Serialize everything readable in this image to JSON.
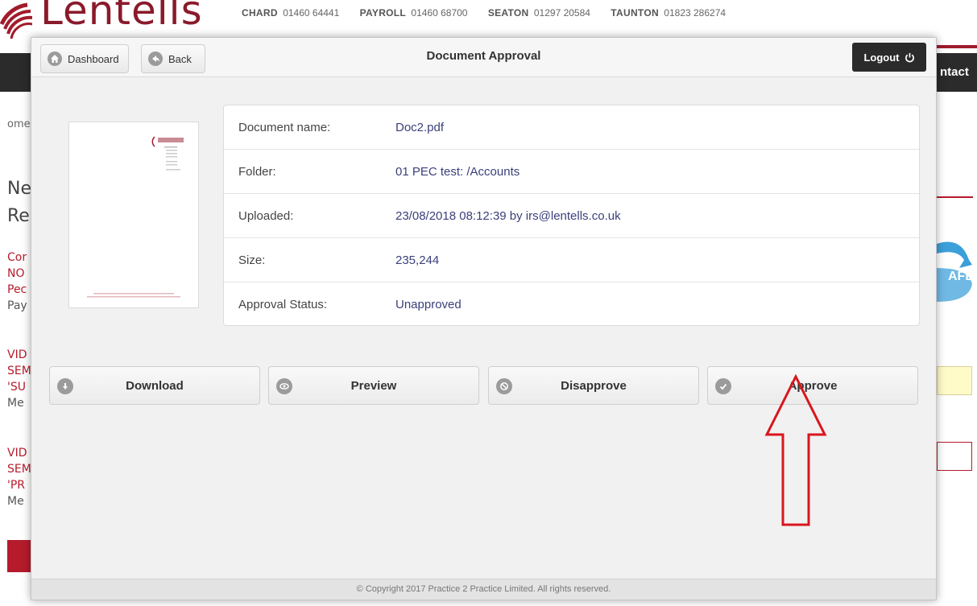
{
  "background": {
    "logo_text": "Lentells",
    "phones": [
      {
        "office": "CHARD",
        "number": "01460 64441"
      },
      {
        "office": "PAYROLL",
        "number": "01460 68700"
      },
      {
        "office": "SEATON",
        "number": "01297 20584"
      },
      {
        "office": "TAUNTON",
        "number": "01823 286274"
      }
    ],
    "nav_fragment": "ntact",
    "left_fragments": {
      "home": "ome",
      "heading_1": "Ne",
      "heading_2": "Re",
      "l1": "Cor",
      "l2": "NO",
      "l3": "Pec",
      "l4": "Pay",
      "l5": "VID",
      "l6": "SEM",
      "l7": "'SU",
      "l8": "Me",
      "l9": "VID",
      "l10": "SEM",
      "l11": "'PR",
      "l12": "Me"
    },
    "badge_fragment": "AFE"
  },
  "header": {
    "dashboard_label": "Dashboard",
    "back_label": "Back",
    "title": "Document Approval",
    "logout_label": "Logout"
  },
  "details": {
    "rows": [
      {
        "label": "Document name:",
        "value": "Doc2.pdf"
      },
      {
        "label": "Folder:",
        "value": "01 PEC test: /Accounts"
      },
      {
        "label": "Uploaded:",
        "value": "23/08/2018 08:12:39 by irs@lentells.co.uk"
      },
      {
        "label": "Size:",
        "value": "235,244"
      },
      {
        "label": "Approval Status:",
        "value": "Unapproved"
      }
    ]
  },
  "actions": {
    "download": "Download",
    "preview": "Preview",
    "disapprove": "Disapprove",
    "approve": "Approve"
  },
  "footer": {
    "copyright": "© Copyright 2017 Practice 2 Practice Limited. All rights reserved."
  },
  "colors": {
    "brand_red": "#a01c2c",
    "dark": "#2b2b2b",
    "link_blue": "#3a3f7a",
    "annotation_red": "#d9161e"
  }
}
